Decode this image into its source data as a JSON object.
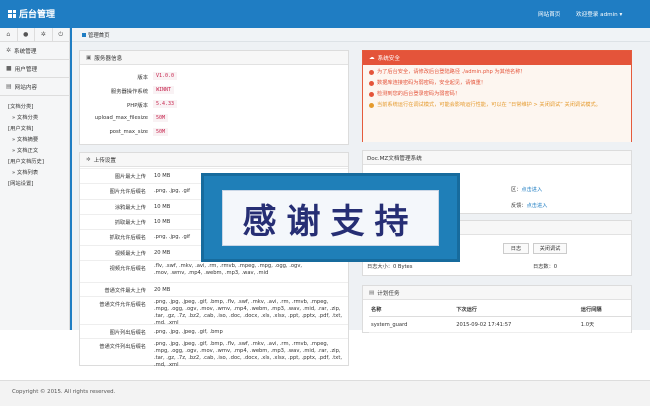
{
  "header": {
    "title": "后台管理",
    "home_link": "网站首页",
    "welcome": "欢迎登录 admin ▾"
  },
  "sidebar": {
    "tools": [
      "home-icon",
      "user-icon",
      "gear-icon",
      "power-icon"
    ],
    "groups": [
      {
        "label": "系统管理",
        "icon": "gear-icon"
      },
      {
        "label": "用户管理",
        "icon": "user-icon"
      },
      {
        "label": "网站内容",
        "icon": "content-icon"
      }
    ],
    "tree": [
      {
        "type": "cat",
        "label": "[文档分类]"
      },
      {
        "type": "sub",
        "label": "» 文档分类"
      },
      {
        "type": "cat",
        "label": "[用户文档]"
      },
      {
        "type": "sub",
        "label": "» 文档摘要"
      },
      {
        "type": "sub",
        "label": "» 文档正文"
      },
      {
        "type": "cat",
        "label": "[用户文档历史]"
      },
      {
        "type": "sub",
        "label": "» 文档列表"
      },
      {
        "type": "cat",
        "label": "[网站设置]"
      }
    ]
  },
  "breadcrumb": "管理首页",
  "server_info": {
    "title": "服务器信息",
    "rows": [
      {
        "k": "版本",
        "v": "V1.0.0"
      },
      {
        "k": "服务器操作系统",
        "v": "WINNT"
      },
      {
        "k": "PHP版本",
        "v": "5.4.33"
      },
      {
        "k": "upload_max_filesize",
        "v": "50M"
      },
      {
        "k": "post_max_size",
        "v": "50M"
      }
    ]
  },
  "upload_settings": {
    "title": "上传设置",
    "rows": [
      {
        "k": "图片最大上传",
        "v": "10 MB"
      },
      {
        "k": "图片允许后缀名",
        "v": ".png, .jpg, .gif"
      },
      {
        "k": "涂鸦最大上传",
        "v": "10 MB"
      },
      {
        "k": "抓取最大上传",
        "v": "10 MB"
      },
      {
        "k": "抓取允许后缀名",
        "v": ".png, .jpg, .gif"
      },
      {
        "k": "视频最大上传",
        "v": "20 MB"
      },
      {
        "k": "视频允许后缀名",
        "v": ".flv, .swf, .mkv, .avi, .rm, .rmvb, .mpeg, .mpg, .ogg, .ogv, .mov, .wmv, .mp4, .webm, .mp3, .wav, .mid"
      },
      {
        "k": "普通文件最大上传",
        "v": "20 MB"
      },
      {
        "k": "普通文件允许后缀名",
        "v": ".png, .jpg, .jpeg, .gif, .bmp, .flv, .swf, .mkv, .avi, .rm, .rmvb, .mpeg, .mpg, .ogg, .ogv, .mov, .wmv, .mp4, .webm, .mp3, .wav, .mid, .rar, .zip, .tar, .gz, .7z, .bz2, .cab, .iso, .doc, .docx, .xls, .xlsx, .ppt, .pptx, .pdf, .txt, .md, .xml"
      },
      {
        "k": "图片列出后缀名",
        "v": ".png, .jpg, .jpeg, .gif, .bmp"
      },
      {
        "k": "普通文件列出后缀名",
        "v": ".png, .jpg, .jpeg, .gif, .bmp, .flv, .swf, .mkv, .avi, .rm, .rmvb, .mpeg, .mpg, .ogg, .ogv, .mov, .wmv, .mp4, .webm, .mp3, .wav, .mid, .rar, .zip, .tar, .gz, .7z, .bz2, .cab, .iso, .doc, .docx, .xls, .xlsx, .ppt, .pptx, .pdf, .txt, .md, .xml"
      }
    ]
  },
  "security": {
    "title": "系统安全",
    "items": [
      {
        "text": "为了后台安全，请修改后台登陆路径 ./admin.php 为其他名称！",
        "level": "danger"
      },
      {
        "text": "数据库连接密码为弱密码，安全起见，请慎重！",
        "level": "danger"
      },
      {
        "text": "检测到您的后台登录密码为弱密码！",
        "level": "danger"
      },
      {
        "text": "当前系统运行在调试模式，可能会影响运行性能，可以在 “日常维护 > 关闭调试” 关闭调试模式。",
        "level": "warn"
      }
    ]
  },
  "docmz": {
    "title": "Doc.MZ文档管理系统",
    "frag1": "区：",
    "link1": "点击进入",
    "frag2": "反馈：",
    "link2": "点击进入"
  },
  "maintenance": {
    "btn_log": "日志",
    "btn_debug": "关闭调试",
    "log_size": "日志大小：0 Bytes",
    "log_count": "日志数：0"
  },
  "tasks": {
    "title": "计划任务",
    "columns": [
      "名称",
      "下次运行",
      "运行间隔"
    ],
    "rows": [
      [
        "system_guard",
        "2015-09-02 17:41:57",
        "1.0天"
      ]
    ]
  },
  "banner": {
    "text": "感谢支持"
  },
  "footer": "Copyright © 2015. All rights reserved.",
  "colors": {
    "primary": "#1f7dc3",
    "danger": "#e4543a",
    "warning": "#e59a2c"
  }
}
